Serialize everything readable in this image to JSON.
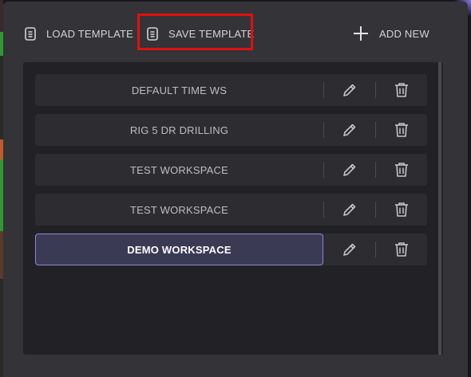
{
  "toolbar": {
    "load_label": "LOAD TEMPLATE",
    "save_label": "SAVE TEMPLATE",
    "add_label": "ADD NEW"
  },
  "workspaces": [
    {
      "name": "DEFAULT TIME WS",
      "selected": false
    },
    {
      "name": "RIG 5 DR DRILLING",
      "selected": false
    },
    {
      "name": "TEST WORKSPACE",
      "selected": false
    },
    {
      "name": "TEST WORKSPACE",
      "selected": false
    },
    {
      "name": "DEMO WORKSPACE",
      "selected": true
    }
  ],
  "icons": {
    "load": "document-icon",
    "save": "document-icon",
    "add": "plus-icon",
    "edit": "pencil-icon",
    "delete": "trash-icon"
  },
  "colors": {
    "highlight": "#e01010",
    "selected_border": "#8f86d9",
    "selected_bg": "#3b3a55"
  }
}
